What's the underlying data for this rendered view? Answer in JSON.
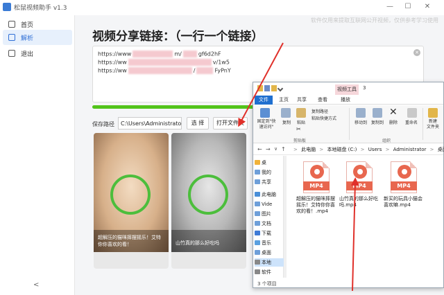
{
  "window": {
    "title": "松鼠视频助手 v1.3",
    "minimize": "—",
    "maximize": "☐",
    "close": "✕"
  },
  "sidebar": {
    "items": [
      {
        "label": "首页",
        "icon": "home-icon"
      },
      {
        "label": "解析",
        "icon": "parse-icon",
        "active": true
      },
      {
        "label": "退出",
        "icon": "exit-icon"
      }
    ],
    "collapse": "<"
  },
  "main": {
    "notice": "软件仅用来提取互联网公开视频，仅供参考学习使用",
    "title": "视频分享链接：（一行一个链接）",
    "links": [
      {
        "prefix": "https://www",
        "mid": "m/",
        "suffix": "gf6d2hF"
      },
      {
        "prefix": "https://ww",
        "mid": "",
        "suffix": "v/1w5"
      },
      {
        "prefix": "https://ww",
        "mid": "/",
        "suffix": "FyPnY"
      }
    ],
    "progress": 1.0,
    "save_label": "保存路径",
    "save_path": "C:\\Users\\Administrator\\",
    "choose_button": "选 择",
    "open_folder_button": "打开文件夹",
    "cards": [
      {
        "caption": "超解压的猫咪摔摆摇乐！艾特你你喜欢的看！"
      },
      {
        "caption": "山竹真的那么好吃吗"
      }
    ]
  },
  "explorer": {
    "context_tab": "视频工具",
    "title_num": "3",
    "tabs": {
      "file": "文件",
      "home": "主页",
      "share": "共享",
      "view": "查看",
      "manage": "播放"
    },
    "ribbon": {
      "pin": "固定到\"快\n速访问\"",
      "copy": "复制",
      "paste": "粘贴",
      "copy_path": "复制路径",
      "paste_shortcut": "粘贴快捷方式",
      "cut": "✂",
      "group_clipboard": "剪贴板",
      "move_to": "移动到",
      "copy_to": "复制到",
      "delete": "删除",
      "rename": "重命名",
      "group_organize": "组织",
      "new_folder": "新建\n文件夹"
    },
    "address": {
      "back": "←",
      "forward": "→",
      "down": "∨",
      "up": "↑",
      "crumbs": [
        "此电脑",
        "本地磁盘 (C:)",
        "Users",
        "Administrator",
        "桌面"
      ],
      "sep": ">"
    },
    "tree": [
      {
        "label": "桌",
        "icon": "star"
      },
      {
        "label": "我的",
        "icon": "folder"
      },
      {
        "label": "共享",
        "icon": "folder"
      },
      {
        "label": "此电脑",
        "icon": "pc"
      },
      {
        "label": "Vide",
        "icon": "folder"
      },
      {
        "label": "图片",
        "icon": "folder"
      },
      {
        "label": "文档",
        "icon": "folder"
      },
      {
        "label": "下载",
        "icon": "dl"
      },
      {
        "label": "音乐",
        "icon": "music"
      },
      {
        "label": "桌面",
        "icon": "folder"
      },
      {
        "label": "本地",
        "icon": "drive",
        "selected": true
      },
      {
        "label": "软件",
        "icon": "drive"
      }
    ],
    "files": [
      {
        "badge": "MP4",
        "name": "超解压的猫咪摔摆摇乐！艾特你你喜欢的看！.mp4"
      },
      {
        "badge": "MP4",
        "name": "山竹真的那么好吃吗.mp4"
      },
      {
        "badge": "MP4",
        "name": "新买的玩具小猫会喜欢嘛.mp4"
      }
    ],
    "status": "3 个项目"
  },
  "colors": {
    "accent": "#2f6fd6",
    "progress": "#52c41a",
    "mp4": "#e8674f",
    "file_tab": "#1f6fcf",
    "annotation": "#e0302a"
  }
}
